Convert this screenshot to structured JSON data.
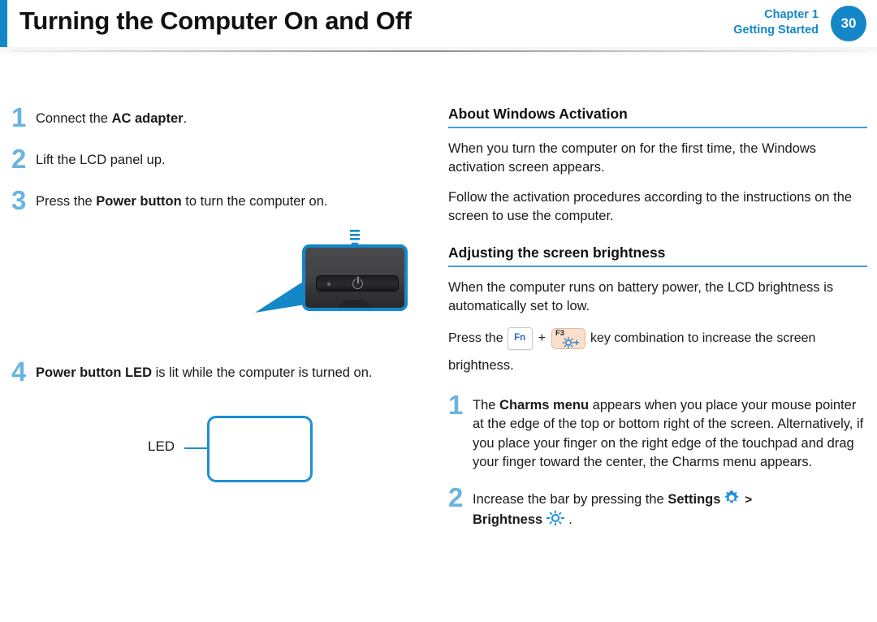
{
  "header": {
    "title": "Turning the Computer On and Off",
    "chapter": "Chapter 1",
    "chapter_section": "Getting Started",
    "page_number": "30",
    "accent_color": "#1487c8"
  },
  "left_column": {
    "steps": [
      {
        "num": "1",
        "pre": "Connect the ",
        "bold": "AC adapter",
        "post": "."
      },
      {
        "num": "2",
        "pre": "Lift the LCD panel up.",
        "bold": "",
        "post": ""
      },
      {
        "num": "3",
        "pre": "Press the ",
        "bold": "Power button",
        "post": " to turn the computer on."
      },
      {
        "num": "4",
        "pre": "",
        "bold": "Power button LED",
        "post": " is lit while the computer is turned on."
      }
    ],
    "power_photo": {
      "caption_icon": "power-symbol-icon",
      "arrow": "down-arrow-icon",
      "callout": "callout-wedge"
    },
    "led_diagram": {
      "label": "LED"
    }
  },
  "right_column": {
    "sections": [
      {
        "heading": "About Windows Activation",
        "paragraphs": [
          "When you turn the computer on for the first time, the Windows activation screen appears.",
          "Follow the activation procedures according to the instructions on the screen to use the computer."
        ]
      },
      {
        "heading": "Adjusting the screen brightness",
        "paragraphs": [
          "When the computer runs on battery power, the LCD brightness is automatically set to low."
        ]
      }
    ],
    "key_combination": {
      "lead_text": "Press the",
      "key_fn": "Fn",
      "plus": "+",
      "key_f3_label": "F3",
      "key_f3_icon": "brightness-up-icon",
      "trail_text": "key combination to increase the screen",
      "tail_text": "brightness."
    },
    "steps": [
      {
        "num": "1",
        "pre": "The ",
        "bold": "Charms menu",
        "post": " appears when you place your mouse pointer at the edge of the top or bottom right of the screen. Alternatively, if you place your finger on the right edge of the touchpad and drag your finger toward the center, the Charms menu appears."
      },
      {
        "num": "2",
        "pre": "Increase the bar by pressing the ",
        "bold": "Settings",
        "icon1": "gear-icon",
        "chevron": ">",
        "bold2": "Brightness",
        "icon2": "brightness-sun-icon",
        "post": "."
      }
    ]
  },
  "colors": {
    "blue_accent": "#1487c8",
    "light_blue_number": "#6ab4e0",
    "heading_rule": "#3e9ee0",
    "key_f3_bg": "#f8e0cd",
    "text": "#1a1a1a"
  }
}
